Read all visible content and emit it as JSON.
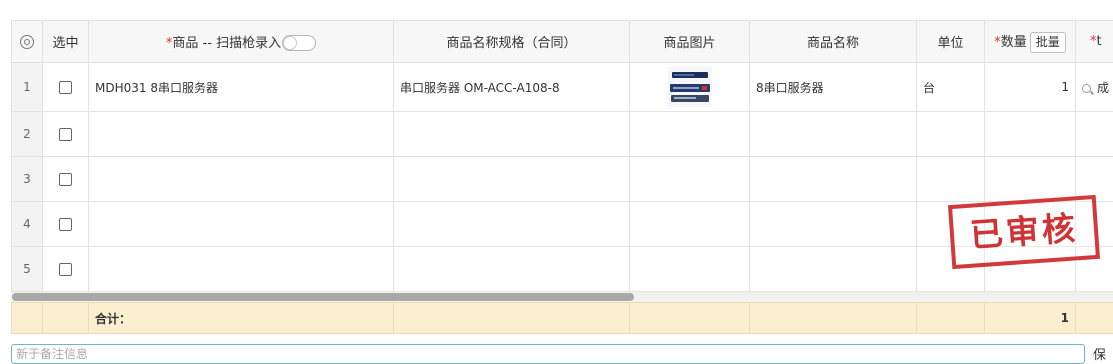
{
  "columns": {
    "select": "选中",
    "product": "商品 -- 扫描枪录入",
    "spec": "商品名称规格（合同）",
    "image": "商品图片",
    "name": "商品名称",
    "unit": "单位",
    "qty": "数量",
    "qty_batch_button": "批量",
    "cut_off": "*t"
  },
  "rows": [
    {
      "index": "1",
      "product": "MDH031 8串口服务器",
      "spec": "串口服务器 OM-ACC-A108-8",
      "name": "8串口服务器",
      "unit": "台",
      "qty": "1",
      "next_partial": "成"
    },
    {
      "index": "2",
      "product": "",
      "spec": "",
      "name": "",
      "unit": "",
      "qty": "",
      "next_partial": ""
    },
    {
      "index": "3",
      "product": "",
      "spec": "",
      "name": "",
      "unit": "",
      "qty": "",
      "next_partial": ""
    },
    {
      "index": "4",
      "product": "",
      "spec": "",
      "name": "",
      "unit": "",
      "qty": "",
      "next_partial": ""
    },
    {
      "index": "5",
      "product": "",
      "spec": "",
      "name": "",
      "unit": "",
      "qty": "",
      "next_partial": ""
    }
  ],
  "footer": {
    "total_label": "合计：",
    "total_qty": "1"
  },
  "remark": {
    "placeholder": "新于备注信息"
  },
  "save_partial": "保",
  "stamp": {
    "text": "已审核",
    "color": "#d23a3a"
  },
  "icons": {
    "settings": "gear-icon",
    "search": "search-icon"
  }
}
